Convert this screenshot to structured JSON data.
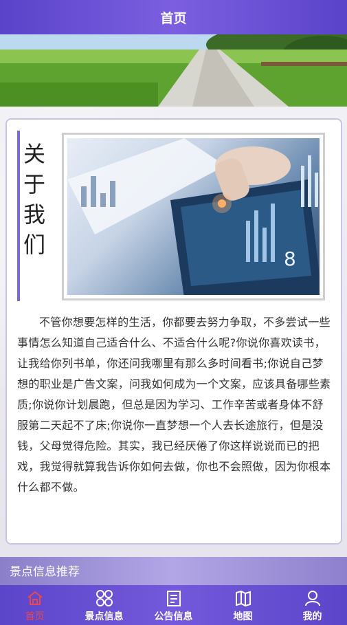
{
  "header": {
    "title": "首页"
  },
  "about": {
    "title_chars": [
      "关",
      "于",
      "我",
      "们"
    ],
    "paragraph": "不管你想要怎样的生活，你都要去努力争取，不多尝试一些事情怎么知道自己适合什么、不适合什么呢?你说你喜欢读书，让我给你列书单，你还问我哪里有那么多时间看书;你说自己梦想的职业是广告文案，问我如何成为一个文案，应该具备哪些素质;你说你计划晨跑，但总是因为学习、工作辛苦或者身体不舒服第二天起不了床;你说你一直梦想一个人去长途旅行，但是没钱，父母觉得危险。其实，我已经厌倦了你这样说说而已的把戏，我觉得就算我告诉你如何去做，你也不会照做，因为你根本什么都不做。"
  },
  "section": {
    "title": "景点信息推荐"
  },
  "tabs": [
    {
      "label": "首页",
      "icon": "home-icon",
      "active": true
    },
    {
      "label": "景点信息",
      "icon": "grid-icon",
      "active": false
    },
    {
      "label": "公告信息",
      "icon": "notice-icon",
      "active": false
    },
    {
      "label": "地图",
      "icon": "map-icon",
      "active": false
    },
    {
      "label": "我的",
      "icon": "user-icon",
      "active": false
    }
  ],
  "colors": {
    "accent": "#6a52d4",
    "active_tab": "#e8474f"
  }
}
